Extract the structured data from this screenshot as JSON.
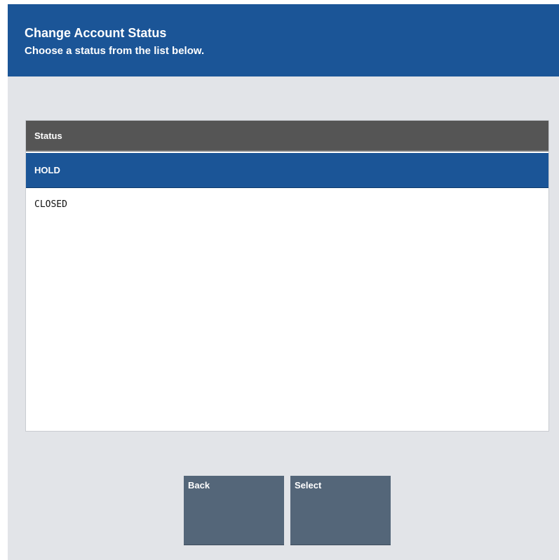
{
  "header": {
    "title": "Change Account Status",
    "subtitle": "Choose a status from the list below."
  },
  "list": {
    "column_header": "Status",
    "items": [
      {
        "label": "HOLD",
        "selected": true
      },
      {
        "label": "CLOSED",
        "selected": false
      }
    ]
  },
  "buttons": {
    "back_label": "Back",
    "select_label": "Select"
  },
  "colors": {
    "header_background": "#1b5597",
    "selected_row": "#1b5597",
    "list_header": "#555555",
    "button": "#546679",
    "screen_background": "#e2e4e8"
  }
}
